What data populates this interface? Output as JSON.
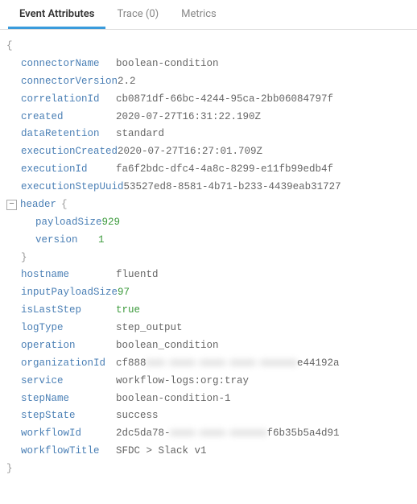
{
  "tabs": {
    "event_attributes": "Event Attributes",
    "trace": "Trace (0)",
    "metrics": "Metrics"
  },
  "attrs": {
    "connectorName": {
      "label": "connectorName",
      "value": "boolean-condition"
    },
    "connectorVersion": {
      "label": "connectorVersion",
      "value": "2.2"
    },
    "correlationId": {
      "label": "correlationId",
      "value": "cb0871df-66bc-4244-95ca-2bb06084797f"
    },
    "created": {
      "label": "created",
      "value": "2020-07-27T16:31:22.190Z"
    },
    "dataRetention": {
      "label": "dataRetention",
      "value": "standard"
    },
    "executionCreated": {
      "label": "executionCreated",
      "value": "2020-07-27T16:27:01.709Z"
    },
    "executionId": {
      "label": "executionId",
      "value": "fa6f2bdc-dfc4-4a8c-8299-e11fb99edb4f"
    },
    "executionStepUuid": {
      "label": "executionStepUuid",
      "value": "53527ed8-8581-4b71-b233-4439eab31727"
    },
    "header": {
      "label": "header",
      "payloadSize": {
        "label": "payloadSize",
        "value": "929"
      },
      "version": {
        "label": "version",
        "value": "1"
      }
    },
    "hostname": {
      "label": "hostname",
      "value": "fluentd"
    },
    "inputPayloadSize": {
      "label": "inputPayloadSize",
      "value": "97"
    },
    "isLastStep": {
      "label": "isLastStep",
      "value": "true"
    },
    "logType": {
      "label": "logType",
      "value": "step_output"
    },
    "operation": {
      "label": "operation",
      "value": "boolean_condition"
    },
    "organizationId": {
      "label": "organizationId",
      "pre": "cf888",
      "blur": "xxx-xxxx-xxxx-xxxx-xxxxxx",
      "post": "e44192a"
    },
    "service": {
      "label": "service",
      "value": "workflow-logs:org:tray"
    },
    "stepName": {
      "label": "stepName",
      "value": "boolean-condition-1"
    },
    "stepState": {
      "label": "stepState",
      "value": "success"
    },
    "workflowId": {
      "label": "workflowId",
      "pre": "2dc5da78-",
      "blur": "xxxx-xxxx-xxxxxx",
      "post": "f6b35b5a4d91"
    },
    "workflowTitle": {
      "label": "workflowTitle",
      "value": "SFDC > Slack v1"
    }
  },
  "glyph": {
    "open_brace": "{",
    "close_brace": "}",
    "minus": "−"
  }
}
